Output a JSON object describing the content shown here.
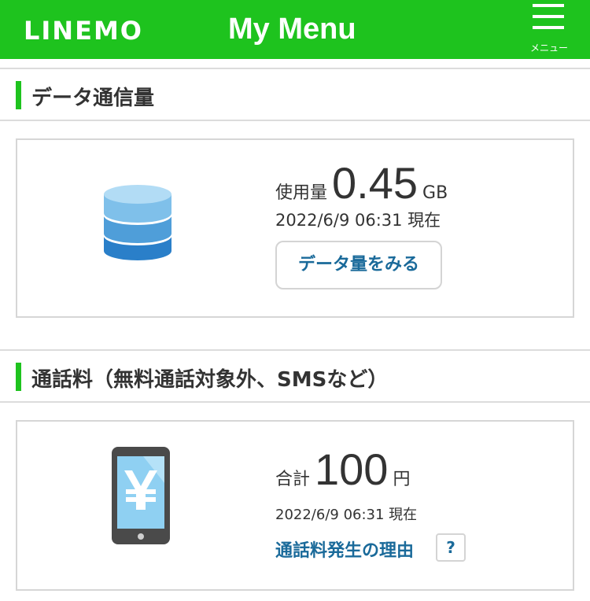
{
  "header": {
    "logo_text": "LINEMO",
    "title": "My Menu",
    "menu_label": "メニュー"
  },
  "colors": {
    "brand_green": "#1ec31e",
    "link_blue": "#1a6a9a",
    "accent_bar": "#1ec31e"
  },
  "data_section": {
    "title": "データ通信量",
    "usage_label": "使用量",
    "usage_value": "0.45",
    "usage_unit": "GB",
    "timestamp": "2022/6/9 06:31 現在",
    "button_label": "データ量をみる",
    "icon": "database-icon"
  },
  "call_section": {
    "title": "通話料（無料通話対象外、SMSなど）",
    "total_label": "合計",
    "total_value": "100",
    "total_unit": "円",
    "timestamp": "2022/6/9 06:31 現在",
    "reason_link": "通話料発生の理由",
    "help_label": "?",
    "icon": "phone-yen-icon"
  }
}
